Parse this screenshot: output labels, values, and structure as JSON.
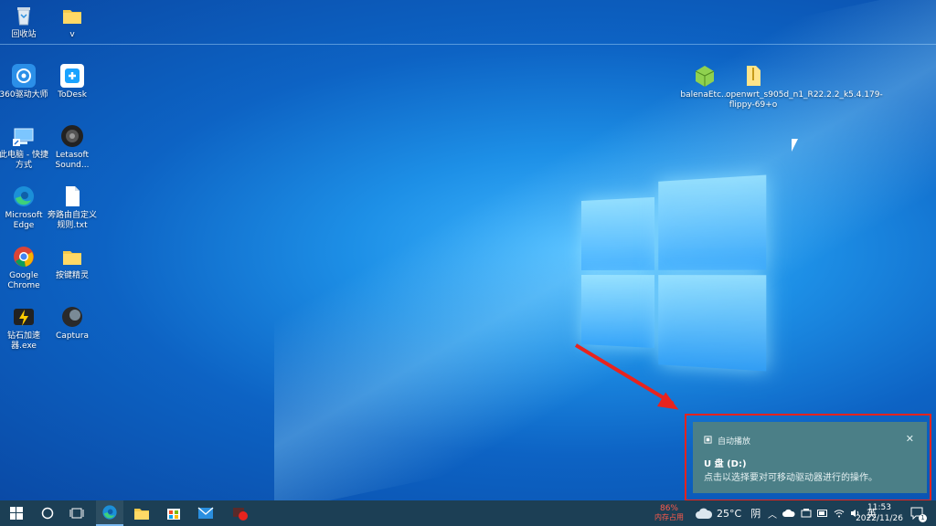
{
  "desktop_icons": [
    {
      "label": "回收站"
    },
    {
      "label": "v"
    },
    {
      "label": "360驱动大师"
    },
    {
      "label": "ToDesk"
    },
    {
      "label": "此电脑 - 快捷方式"
    },
    {
      "label": "Letasoft Sound..."
    },
    {
      "label": "Microsoft Edge"
    },
    {
      "label": "旁路由自定义规则.txt"
    },
    {
      "label": "Google Chrome"
    },
    {
      "label": "按键精灵"
    },
    {
      "label": "钻石加速器.exe"
    },
    {
      "label": "Captura"
    },
    {
      "label": "balenaEtc..."
    },
    {
      "label": "openwrt_s905d_n1_R22.2.2_k5.4.179-flippy-69+o"
    }
  ],
  "notification": {
    "app": "自动播放",
    "title": "U 盘 (D:)",
    "message": "点击以选择要对可移动驱动器进行的操作。",
    "close": "✕"
  },
  "taskbar": {
    "memory_percent": "86%",
    "memory_label": "内存占用",
    "weather_temp": "25°C",
    "weather_cond": "阴",
    "ime": "英",
    "time": "11:53",
    "date": "2022/11/26",
    "notification_count": "1"
  },
  "colors": {
    "toast_bg": "#4b7f87",
    "highlight": "#e8231e",
    "taskbar_bg": "#1c3f55",
    "memory_text": "#ff5a4a"
  }
}
